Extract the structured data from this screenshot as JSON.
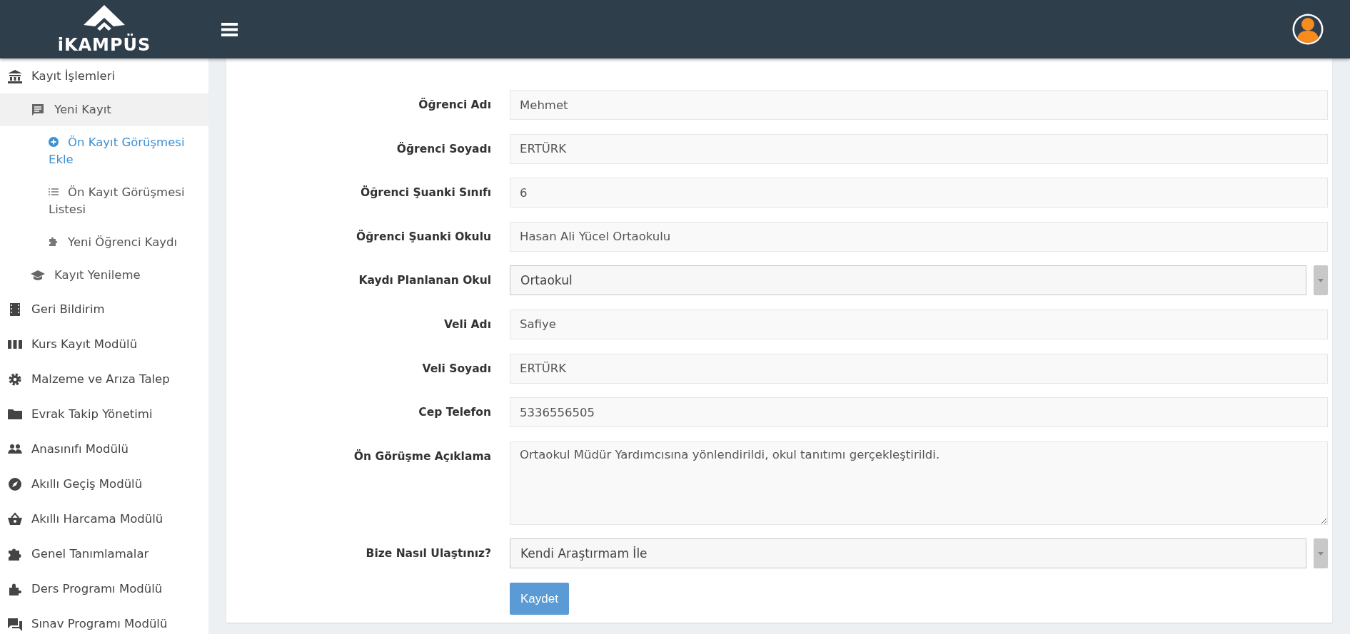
{
  "logo": {
    "text": "iKAMPÜS"
  },
  "sidebar": {
    "items": [
      {
        "label": "Kayıt İşlemleri",
        "selected": false,
        "children": [
          {
            "label": "Yeni Kayıt",
            "expanded": true,
            "selected": false,
            "children": [
              {
                "label": "Ön Kayıt Görüşmesi Ekle",
                "selected": true
              },
              {
                "label": "Ön Kayıt Görüşmesi Listesi",
                "selected": false
              },
              {
                "label": "Yeni Öğrenci Kaydı",
                "selected": false
              }
            ]
          },
          {
            "label": "Kayıt Yenileme",
            "selected": false
          }
        ]
      },
      {
        "label": "Geri Bildirim",
        "selected": false
      },
      {
        "label": "Kurs Kayıt Modülü",
        "selected": false
      },
      {
        "label": "Malzeme ve Arıza Talep",
        "selected": false
      },
      {
        "label": "Evrak Takip Yönetimi",
        "selected": false
      },
      {
        "label": "Anasınıfı Modülü",
        "selected": false
      },
      {
        "label": "Akıllı Geçiş Modülü",
        "selected": false
      },
      {
        "label": "Akıllı Harcama Modülü",
        "selected": false
      },
      {
        "label": "Genel Tanımlamalar",
        "selected": false
      },
      {
        "label": "Ders Programı Modülü",
        "selected": false
      },
      {
        "label": "Sınav Programı Modülü",
        "selected": false
      }
    ]
  },
  "form": {
    "fields": [
      {
        "kind": "text",
        "label": "Öğrenci Adı",
        "value": "Mehmet"
      },
      {
        "kind": "text",
        "label": "Öğrenci Soyadı",
        "value": "ERTÜRK"
      },
      {
        "kind": "text",
        "label": "Öğrenci Şuanki Sınıfı",
        "value": "6"
      },
      {
        "kind": "text",
        "label": "Öğrenci Şuanki Okulu",
        "value": "Hasan Ali Yücel Ortaokulu"
      },
      {
        "kind": "select",
        "label": "Kaydı Planlanan Okul",
        "value": "Ortaokul"
      },
      {
        "kind": "text",
        "label": "Veli Adı",
        "value": "Safiye"
      },
      {
        "kind": "text",
        "label": "Veli Soyadı",
        "value": "ERTÜRK"
      },
      {
        "kind": "text",
        "label": "Cep Telefon",
        "value": "5336556505"
      },
      {
        "kind": "textarea",
        "label": "Ön Görüşme Açıklama",
        "value": "Ortaokul Müdür Yardımcısına yönlendirildi, okul tanıtımı gerçekleştirildi."
      },
      {
        "kind": "select",
        "label": "Bize Nasıl Ulaştınız?",
        "value": "Kendi Araştırmam İle"
      }
    ],
    "submit": "Kaydet"
  }
}
